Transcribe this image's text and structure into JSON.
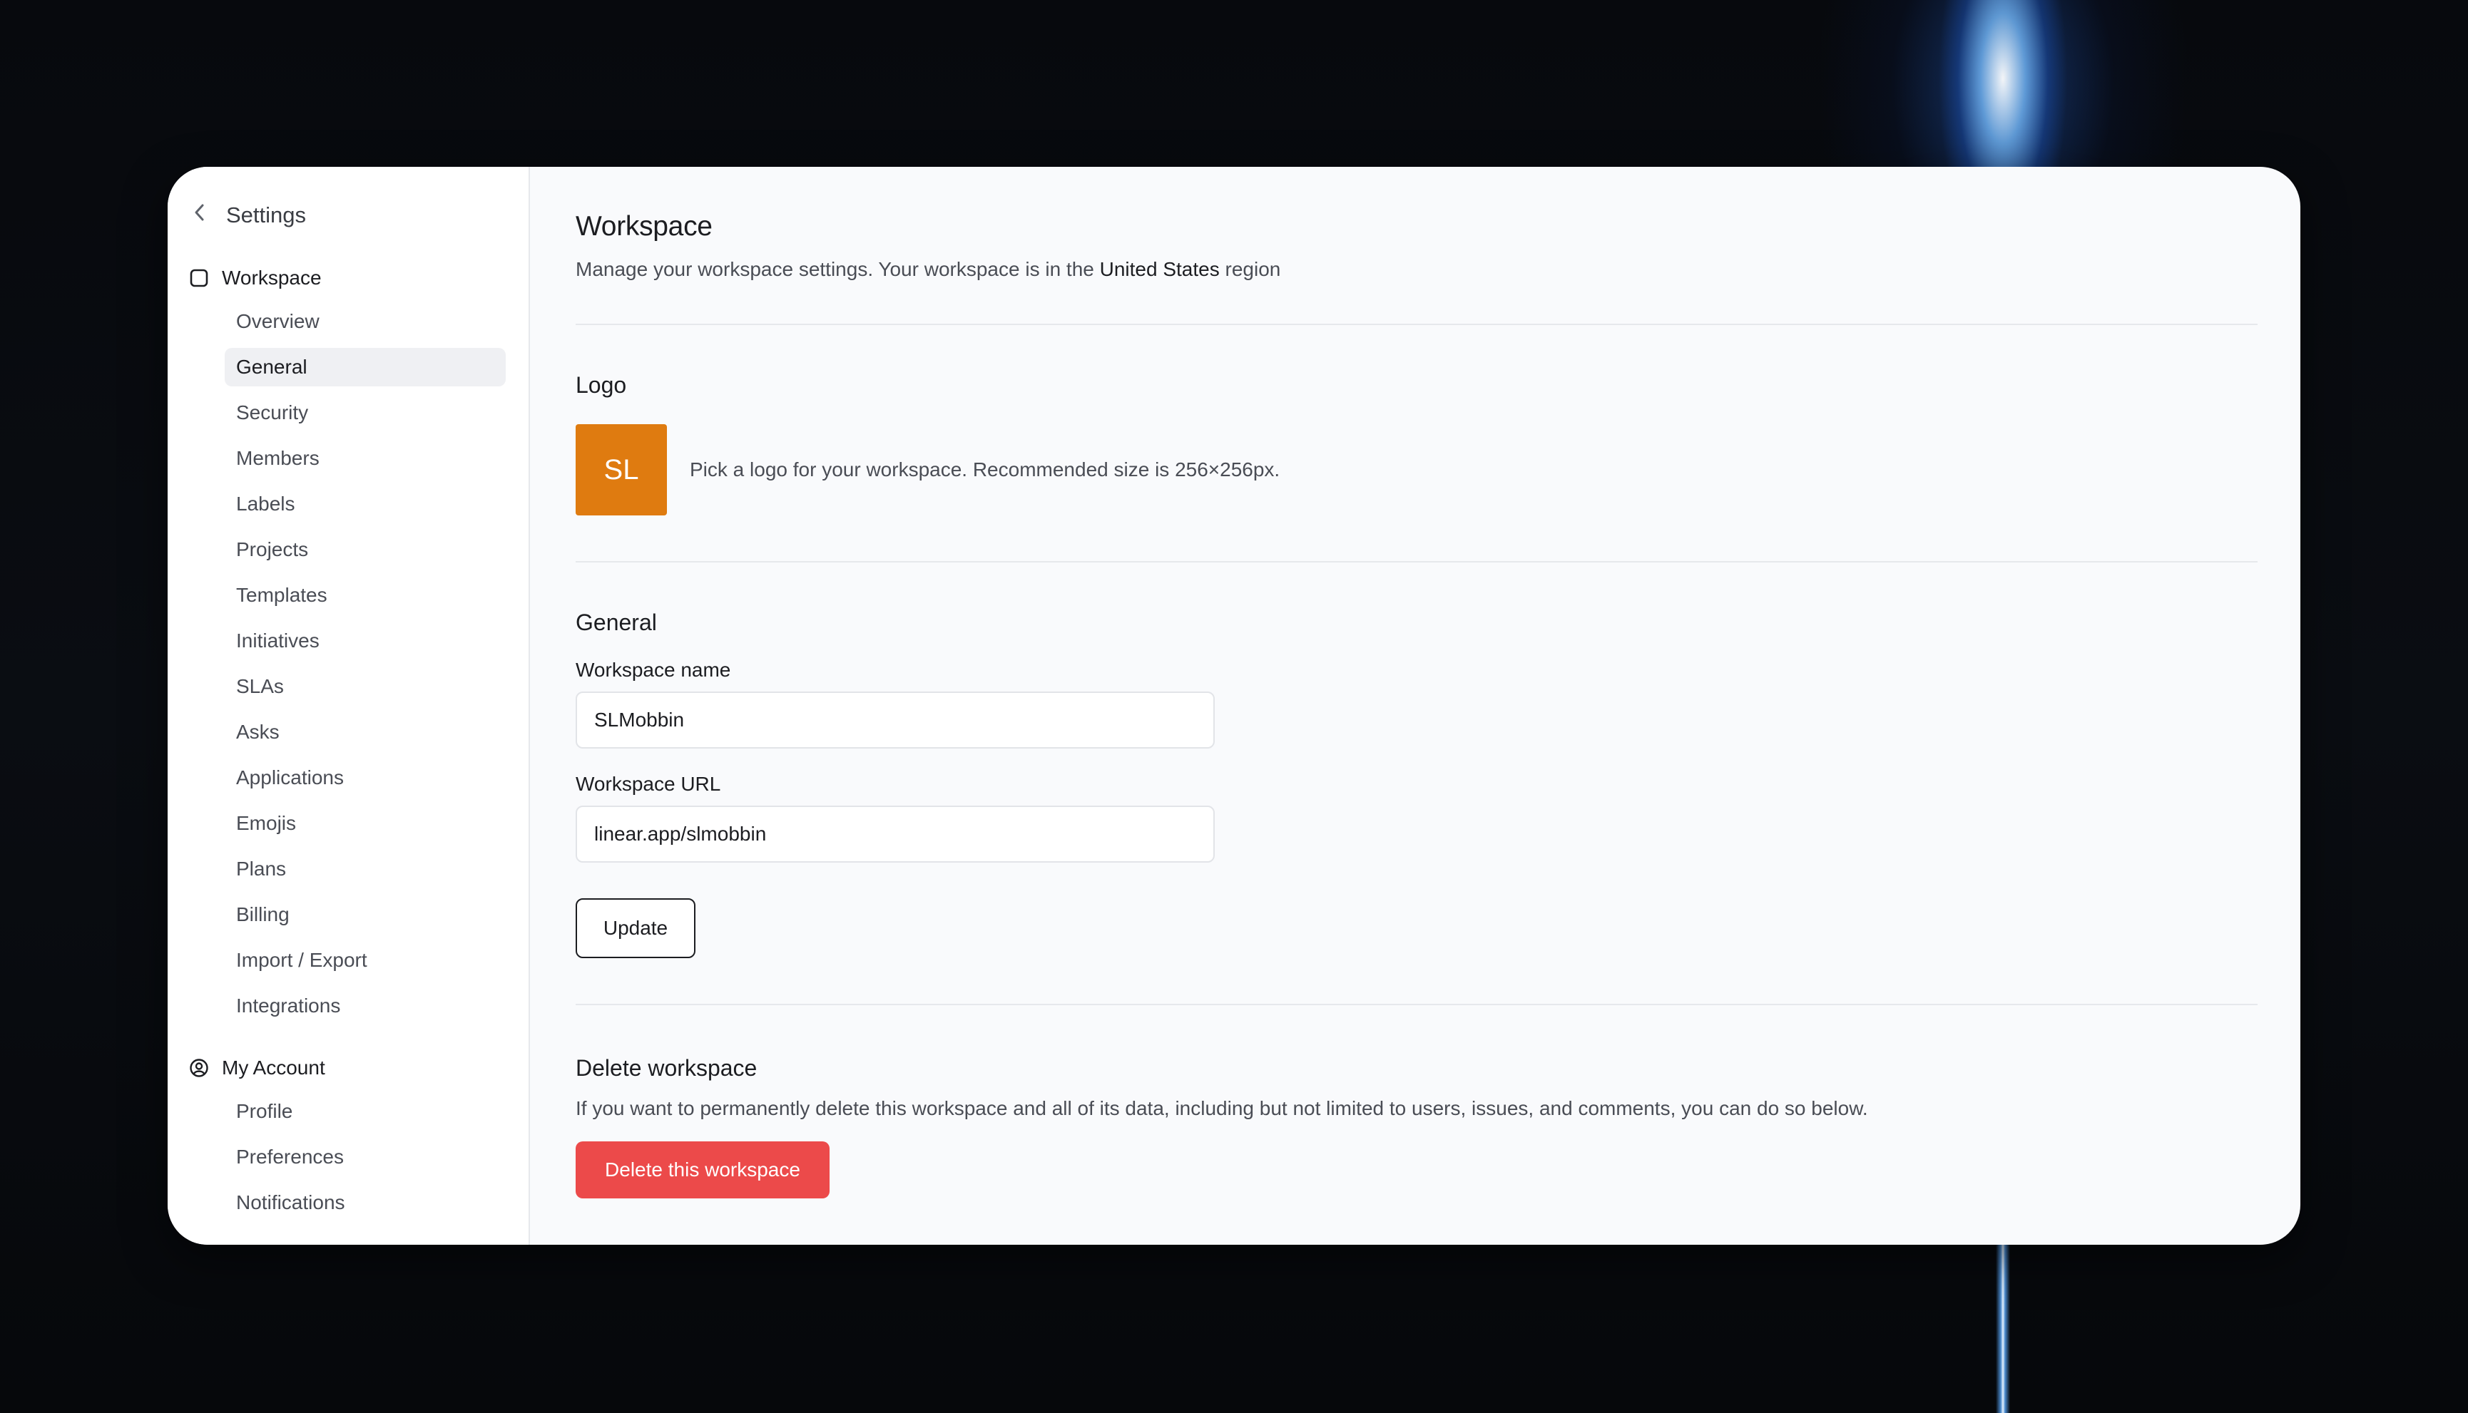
{
  "colors": {
    "accent_logo": "#df7b10",
    "danger": "#ec4a4a",
    "beam": "#7ab8ff"
  },
  "sidebar": {
    "back_label": "Settings",
    "workspace_group": {
      "title": "Workspace",
      "items": [
        "Overview",
        "General",
        "Security",
        "Members",
        "Labels",
        "Projects",
        "Templates",
        "Initiatives",
        "SLAs",
        "Asks",
        "Applications",
        "Emojis",
        "Plans",
        "Billing",
        "Import / Export",
        "Integrations"
      ],
      "active_item": "General"
    },
    "account_group": {
      "title": "My Account",
      "items": [
        "Profile",
        "Preferences",
        "Notifications"
      ]
    }
  },
  "header": {
    "title": "Workspace",
    "subtitle_prefix": "Manage your workspace settings. Your workspace is in the",
    "region": "United States",
    "subtitle_suffix": "region"
  },
  "logo_section": {
    "title": "Logo",
    "initials": "SL",
    "hint": "Pick a logo for your workspace. Recommended size is 256×256px."
  },
  "general_section": {
    "title": "General",
    "name_label": "Workspace name",
    "name_value": "SLMobbin",
    "url_label": "Workspace URL",
    "url_value": "linear.app/slmobbin",
    "update_label": "Update"
  },
  "delete_section": {
    "title": "Delete workspace",
    "description": "If you want to permanently delete this workspace and all of its data, including but not limited to users, issues, and comments, you can do so below.",
    "button_label": "Delete this workspace"
  }
}
